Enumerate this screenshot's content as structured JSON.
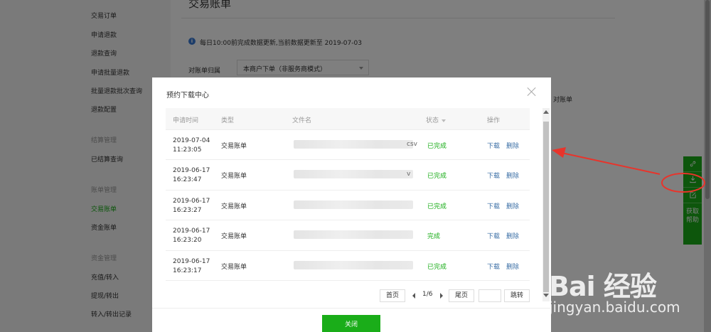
{
  "sidebar": {
    "items": [
      {
        "label": "交易订单",
        "type": "item"
      },
      {
        "label": "申请退款",
        "type": "item"
      },
      {
        "label": "退款查询",
        "type": "item"
      },
      {
        "label": "申请批量退款",
        "type": "item"
      },
      {
        "label": "批量退款批次查询",
        "type": "item"
      },
      {
        "label": "退款配置",
        "type": "item"
      },
      {
        "label": "结算管理",
        "type": "group"
      },
      {
        "label": "已结算查询",
        "type": "item"
      },
      {
        "label": "账单管理",
        "type": "group"
      },
      {
        "label": "交易账单",
        "type": "item",
        "active": true
      },
      {
        "label": "资金账单",
        "type": "item"
      },
      {
        "label": "资金管理",
        "type": "group"
      },
      {
        "label": "充值/转入",
        "type": "item"
      },
      {
        "label": "提现/转出",
        "type": "item"
      },
      {
        "label": "转入/转出记录",
        "type": "item"
      }
    ]
  },
  "main": {
    "title": "交易账单",
    "info_icon": "info-icon",
    "info_text": "每日10:00前完成数据更新,当前数据更新至 2019-07-03",
    "filter_label": "对账单归属",
    "filter_value": "本商户下单（非服务商模式）",
    "behind_text": "对账单"
  },
  "float_toolbar": {
    "icons": [
      "link-icon",
      "download-icon",
      "edit-icon"
    ],
    "help_label": "获取帮助"
  },
  "modal": {
    "title": "预约下载中心",
    "columns": {
      "time": "申请时间",
      "type": "类型",
      "file": "文件名",
      "status": "状态",
      "actions": "操作"
    },
    "rows": [
      {
        "date": "2019-07-04",
        "time": "11:23:05",
        "type": "交易账单",
        "file_tail": "csv",
        "status": "已完成",
        "download": "下载",
        "delete": "删除"
      },
      {
        "date": "2019-06-17",
        "time": "16:23:47",
        "type": "交易账单",
        "file_tail": "v",
        "status": "已完成",
        "download": "下载",
        "delete": "删除"
      },
      {
        "date": "2019-06-17",
        "time": "16:23:27",
        "type": "交易账单",
        "file_tail": "",
        "status": "已完成",
        "download": "下载",
        "delete": "删除"
      },
      {
        "date": "2019-06-17",
        "time": "16:23:20",
        "type": "交易账单",
        "file_tail": "",
        "status": "完成",
        "download": "下载",
        "delete": "删除"
      },
      {
        "date": "2019-06-17",
        "time": "16:23:17",
        "type": "交易账单",
        "file_tail": "",
        "status": "已完成",
        "download": "下载",
        "delete": "删除"
      }
    ],
    "pager": {
      "first": "首页",
      "page_info": "1/6",
      "last": "尾页",
      "jump": "跳转"
    },
    "close_label": "关闭"
  },
  "watermark": {
    "text": "Bai 经验",
    "url": "jingyan.baidu.com"
  },
  "colors": {
    "accent": "#1aad19",
    "link": "#3a6ea5",
    "annotation": "#e8342b"
  }
}
